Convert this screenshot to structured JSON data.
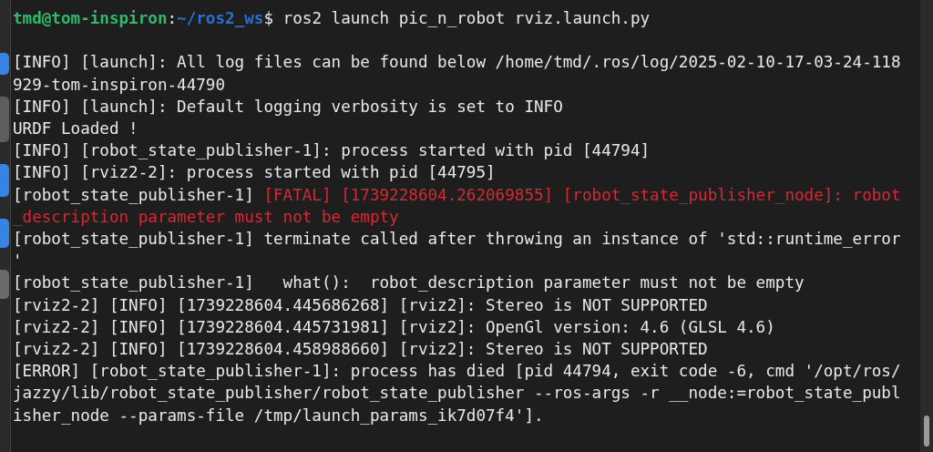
{
  "terminal": {
    "prompt": {
      "user_host": "tmd@tom-inspiron",
      "separator": ":",
      "path": "~/ros2_ws",
      "command": "$ ros2 launch pic_n_robot rviz.launch.py"
    },
    "rows": [
      {
        "segments": [
          {
            "text": "[INFO] [launch]: All log files can be found below /home/tmd/.ros/log/2025-02-10-17-03-24-118",
            "kind": "normal"
          }
        ]
      },
      {
        "segments": [
          {
            "text": "929-tom-inspiron-44790",
            "kind": "normal"
          }
        ]
      },
      {
        "segments": [
          {
            "text": "[INFO] [launch]: Default logging verbosity is set to INFO",
            "kind": "normal"
          }
        ]
      },
      {
        "segments": [
          {
            "text": "URDF Loaded !",
            "kind": "normal"
          }
        ]
      },
      {
        "segments": [
          {
            "text": "[INFO] [robot_state_publisher-1]: process started with pid [44794]",
            "kind": "normal"
          }
        ]
      },
      {
        "segments": [
          {
            "text": "[INFO] [rviz2-2]: process started with pid [44795]",
            "kind": "normal"
          }
        ]
      },
      {
        "segments": [
          {
            "text": "[robot_state_publisher-1] ",
            "kind": "normal"
          },
          {
            "text": "[FATAL] [1739228604.262069855] [robot_state_publisher_node]: robot",
            "kind": "error"
          }
        ]
      },
      {
        "segments": [
          {
            "text": "_description parameter must not be empty",
            "kind": "error"
          }
        ]
      },
      {
        "segments": [
          {
            "text": "[robot_state_publisher-1] terminate called after throwing an instance of 'std::runtime_error",
            "kind": "normal"
          }
        ]
      },
      {
        "segments": [
          {
            "text": "'",
            "kind": "normal"
          }
        ]
      },
      {
        "segments": [
          {
            "text": "[robot_state_publisher-1]   what():  robot_description parameter must not be empty",
            "kind": "normal"
          }
        ]
      },
      {
        "segments": [
          {
            "text": "[rviz2-2] [INFO] [1739228604.445686268] [rviz2]: Stereo is NOT SUPPORTED",
            "kind": "normal"
          }
        ]
      },
      {
        "segments": [
          {
            "text": "[rviz2-2] [INFO] [1739228604.445731981] [rviz2]: OpenGl version: 4.6 (GLSL 4.6)",
            "kind": "normal"
          }
        ]
      },
      {
        "segments": [
          {
            "text": "[rviz2-2] [INFO] [1739228604.458988660] [rviz2]: Stereo is NOT SUPPORTED",
            "kind": "normal"
          }
        ]
      },
      {
        "segments": [
          {
            "text": "[ERROR] [robot_state_publisher-1]: process has died [pid 44794, exit code -6, cmd '/opt/ros/",
            "kind": "normal"
          }
        ]
      },
      {
        "segments": [
          {
            "text": "jazzy/lib/robot_state_publisher/robot_state_publisher --ros-args -r __node:=robot_state_publ",
            "kind": "normal"
          }
        ]
      },
      {
        "segments": [
          {
            "text": "isher_node --params-file /tmp/launch_params_ik7d07f4'].",
            "kind": "normal"
          }
        ]
      }
    ]
  }
}
